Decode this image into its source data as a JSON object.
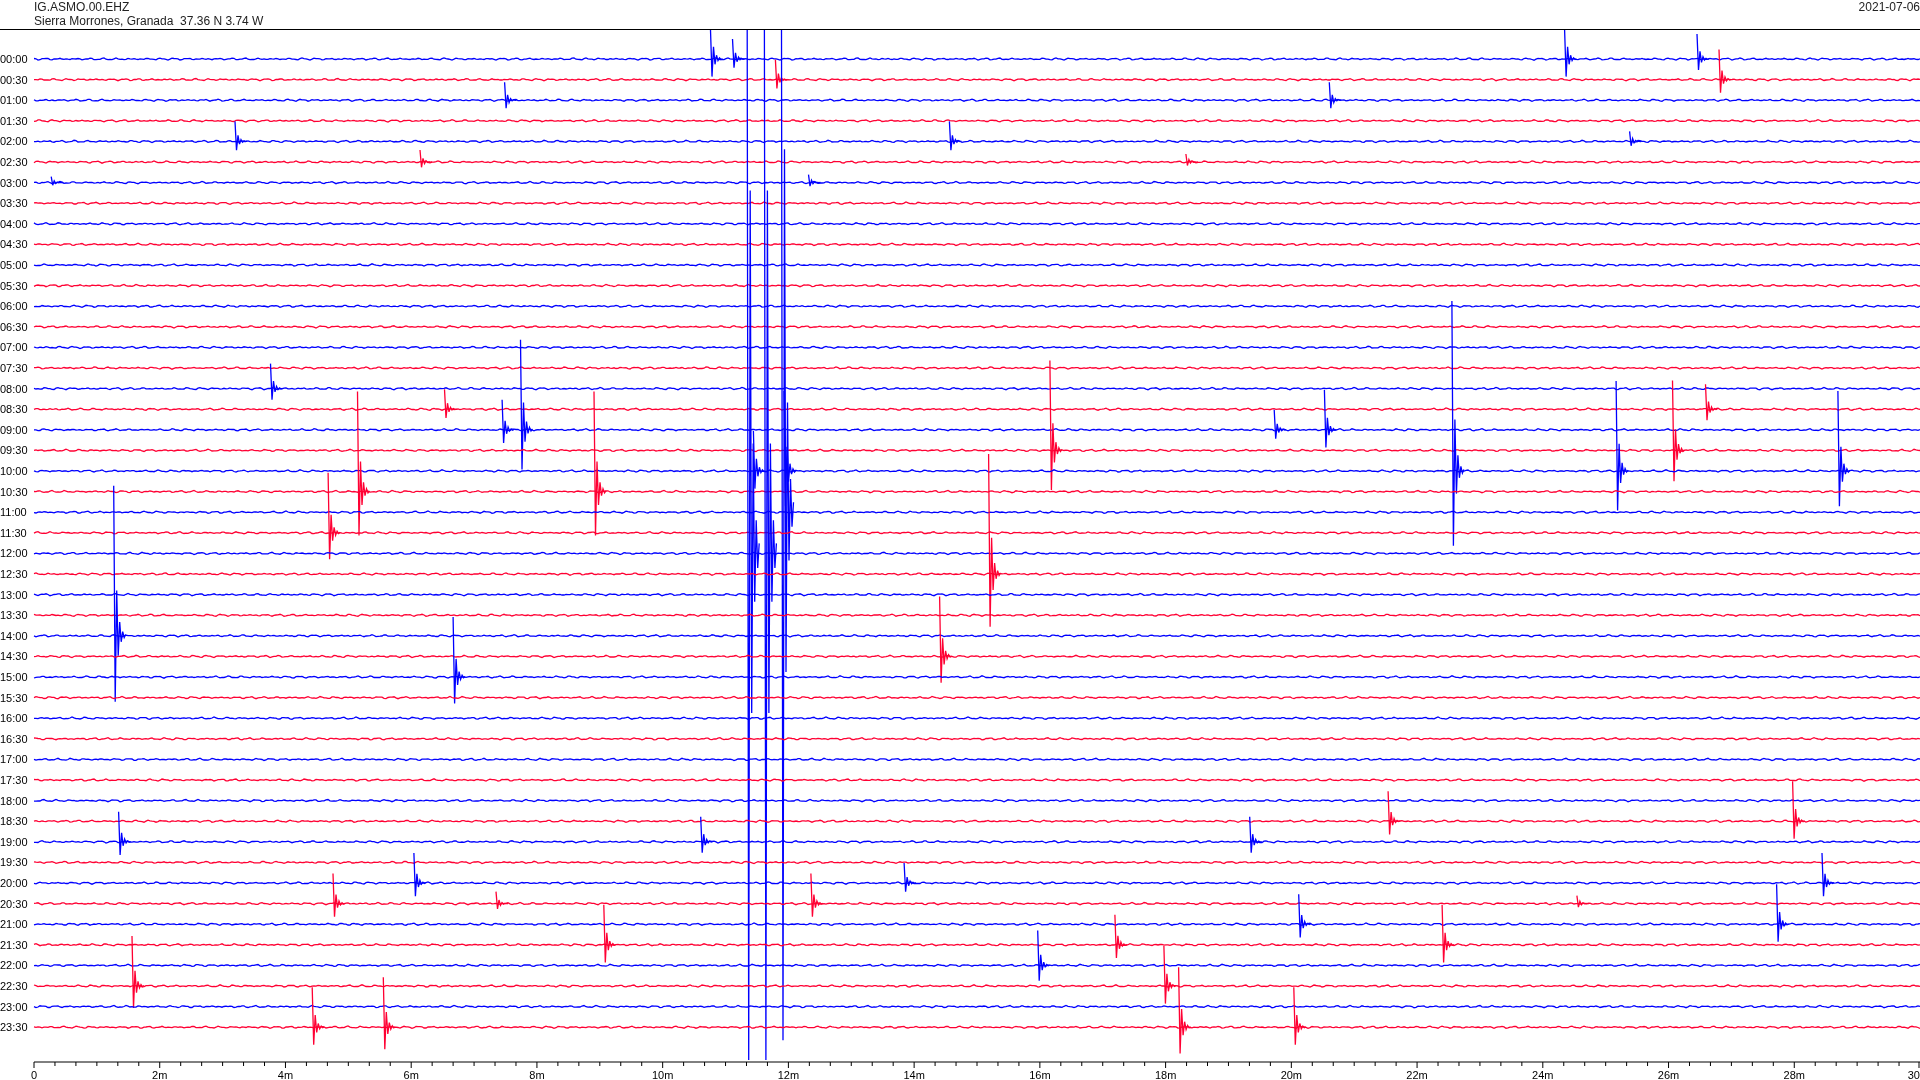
{
  "header": {
    "station": "IG.ASMO.00.EHZ",
    "location": "Sierra Morrones, Granada  37.36 N 3.74 W",
    "date": "2021-07-06"
  },
  "helicorder": {
    "rows": [
      {
        "time": "00:00",
        "color": "#0000ff"
      },
      {
        "time": "00:30",
        "color": "#ff0033"
      },
      {
        "time": "01:00",
        "color": "#0000ff"
      },
      {
        "time": "01:30",
        "color": "#ff0033"
      },
      {
        "time": "02:00",
        "color": "#0000ff"
      },
      {
        "time": "02:30",
        "color": "#ff0033"
      },
      {
        "time": "03:00",
        "color": "#0000ff"
      },
      {
        "time": "03:30",
        "color": "#ff0033"
      },
      {
        "time": "04:00",
        "color": "#0000ff"
      },
      {
        "time": "04:30",
        "color": "#ff0033"
      },
      {
        "time": "05:00",
        "color": "#0000ff"
      },
      {
        "time": "05:30",
        "color": "#ff0033"
      },
      {
        "time": "06:00",
        "color": "#0000ff"
      },
      {
        "time": "06:30",
        "color": "#ff0033"
      },
      {
        "time": "07:00",
        "color": "#0000ff"
      },
      {
        "time": "07:30",
        "color": "#ff0033"
      },
      {
        "time": "08:00",
        "color": "#0000ff"
      },
      {
        "time": "08:30",
        "color": "#ff0033"
      },
      {
        "time": "09:00",
        "color": "#0000ff"
      },
      {
        "time": "09:30",
        "color": "#ff0033"
      },
      {
        "time": "10:00",
        "color": "#0000ff"
      },
      {
        "time": "10:30",
        "color": "#ff0033"
      },
      {
        "time": "11:00",
        "color": "#0000ff"
      },
      {
        "time": "11:30",
        "color": "#ff0033"
      },
      {
        "time": "12:00",
        "color": "#0000ff"
      },
      {
        "time": "12:30",
        "color": "#ff0033"
      },
      {
        "time": "13:00",
        "color": "#0000ff"
      },
      {
        "time": "13:30",
        "color": "#ff0033"
      },
      {
        "time": "14:00",
        "color": "#0000ff"
      },
      {
        "time": "14:30",
        "color": "#ff0033"
      },
      {
        "time": "15:00",
        "color": "#0000ff"
      },
      {
        "time": "15:30",
        "color": "#ff0033"
      },
      {
        "time": "16:00",
        "color": "#0000ff"
      },
      {
        "time": "16:30",
        "color": "#ff0033"
      },
      {
        "time": "17:00",
        "color": "#0000ff"
      },
      {
        "time": "17:30",
        "color": "#ff0033"
      },
      {
        "time": "18:00",
        "color": "#0000ff"
      },
      {
        "time": "18:30",
        "color": "#ff0033"
      },
      {
        "time": "19:00",
        "color": "#0000ff"
      },
      {
        "time": "19:30",
        "color": "#ff0033"
      },
      {
        "time": "20:00",
        "color": "#0000ff"
      },
      {
        "time": "20:30",
        "color": "#ff0033"
      },
      {
        "time": "21:00",
        "color": "#0000ff"
      },
      {
        "time": "21:30",
        "color": "#ff0033"
      },
      {
        "time": "22:00",
        "color": "#0000ff"
      },
      {
        "time": "22:30",
        "color": "#ff0033"
      },
      {
        "time": "23:00",
        "color": "#0000ff"
      },
      {
        "time": "23:30",
        "color": "#ff0033"
      }
    ],
    "x_ticks": [
      "0",
      "2m",
      "4m",
      "6m",
      "8m",
      "10m",
      "12m",
      "14m",
      "16m",
      "18m",
      "20m",
      "22m",
      "24m",
      "26m",
      "28m",
      "30"
    ]
  }
}
